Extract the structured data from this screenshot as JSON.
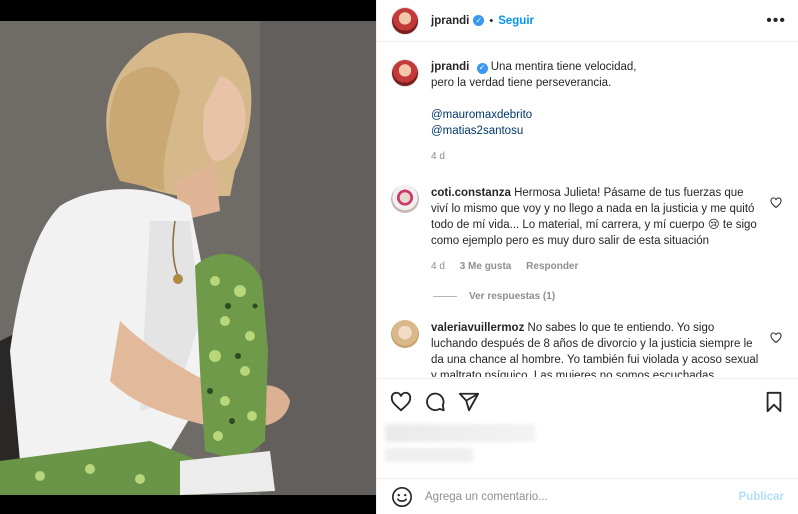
{
  "header": {
    "username": "jprandi",
    "separator": "•",
    "follow_label": "Seguir",
    "more_label": "•••"
  },
  "caption": {
    "username": "jprandi",
    "text_line1": "Una mentira tiene velocidad,",
    "text_line2": "pero la verdad tiene perseverancia.",
    "mention1": "@mauromaxdebrito",
    "mention2": "@matias2santosu",
    "time": "4 d"
  },
  "comments": [
    {
      "username": "coti.constanza",
      "text": "Hermosa Julieta! Pásame de tus fuerzas que viví lo mismo que voy y no llego a nada en la justicia y me quitó todo de mí vida... Lo material, mí carrera, y mí cuerpo 😢 te sigo como ejemplo pero es muy duro salir de esta situación",
      "time": "4 d",
      "likes": "3 Me gusta",
      "reply_label": "Responder",
      "view_replies": "Ver respuestas (1)"
    },
    {
      "username": "valeriavuillermoz",
      "text": "No sabes lo que te entiendo. Yo sigo luchando después de 8 años de divorcio y la justicia siempre le da una chance al hombre. Yo también fui violada y acoso sexual y maltrato psíquico. Las mujeres no somos escuchadas."
    }
  ],
  "add_comment": {
    "placeholder": "Agrega un comentario...",
    "publish_label": "Publicar"
  },
  "icons": {
    "like": "heart-icon",
    "comment": "comment-icon",
    "share": "share-icon",
    "save": "bookmark-icon",
    "emoji": "emoji-icon"
  },
  "colors": {
    "accent": "#0095f6",
    "verified": "#3897f0",
    "publish_disabled": "#b2dffc",
    "mention": "#00376b"
  }
}
